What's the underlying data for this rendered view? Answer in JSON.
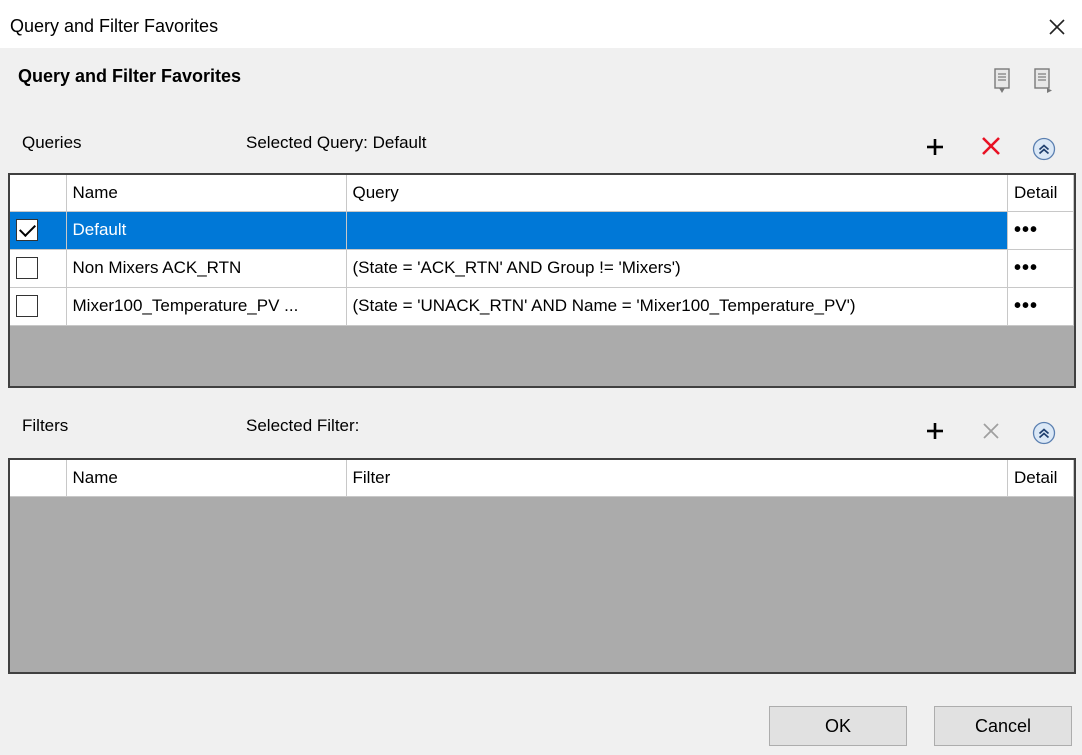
{
  "window": {
    "title": "Query and Filter Favorites",
    "close_icon": "close-icon"
  },
  "dialog": {
    "heading": "Query and Filter Favorites",
    "import_icon": "import-favorites-icon",
    "export_icon": "export-favorites-icon"
  },
  "queries": {
    "label": "Queries",
    "selected_label": "Selected Query: Default",
    "add_icon": "plus-icon",
    "delete_icon": "delete-x-icon",
    "collapse_icon": "collapse-up-icon",
    "columns": {
      "name": "Name",
      "query": "Query",
      "detail": "Detail"
    },
    "rows": [
      {
        "checked": true,
        "selected": true,
        "name": "Default",
        "query": "",
        "detail": "•••"
      },
      {
        "checked": false,
        "selected": false,
        "name": "Non Mixers ACK_RTN",
        "query": "(State = 'ACK_RTN' AND Group != 'Mixers')",
        "detail": "•••"
      },
      {
        "checked": false,
        "selected": false,
        "name": "Mixer100_Temperature_PV ...",
        "query": "(State = 'UNACK_RTN' AND Name = 'Mixer100_Temperature_PV')",
        "detail": "•••"
      }
    ]
  },
  "filters": {
    "label": "Filters",
    "selected_label": "Selected Filter:",
    "add_icon": "plus-icon",
    "delete_icon": "delete-x-icon-disabled",
    "collapse_icon": "collapse-up-icon",
    "columns": {
      "name": "Name",
      "filter": "Filter",
      "detail": "Detail"
    },
    "rows": []
  },
  "buttons": {
    "ok": "OK",
    "cancel": "Cancel"
  },
  "colors": {
    "selection": "#0078d7",
    "delete_red": "#e81123",
    "grid_empty": "#ababab",
    "dialog_bg": "#f0f0f0"
  }
}
